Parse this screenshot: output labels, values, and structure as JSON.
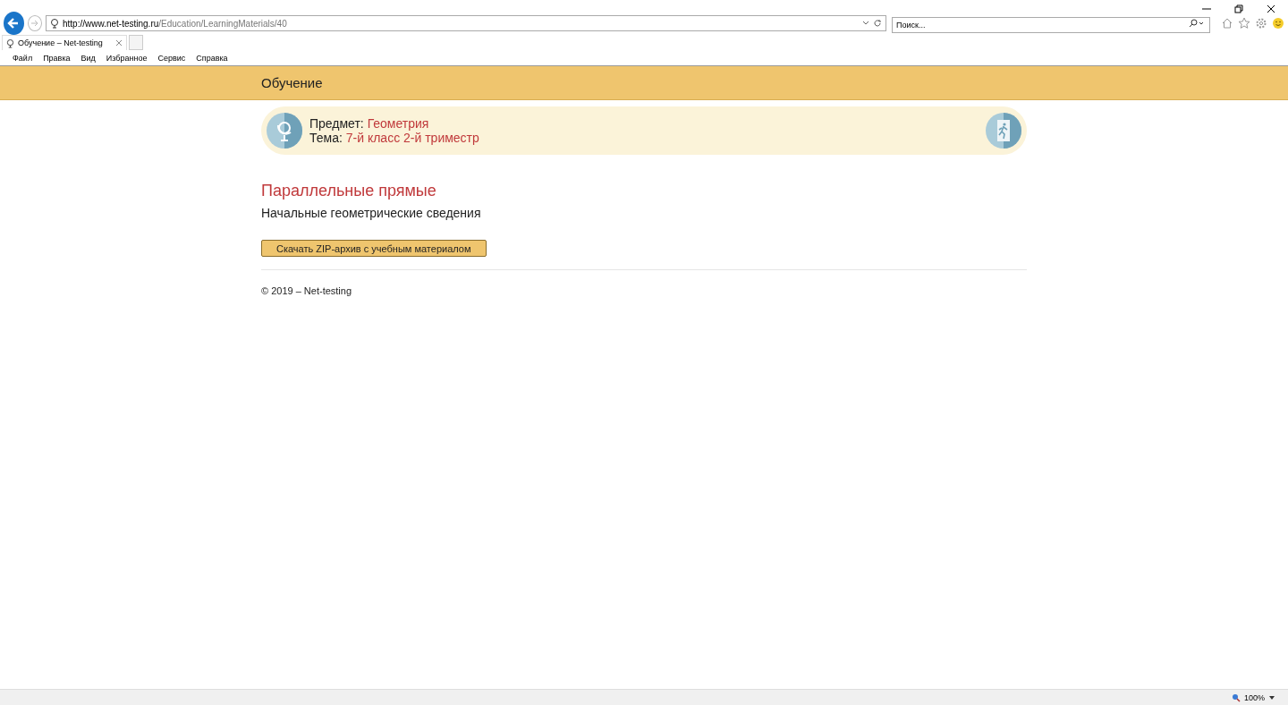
{
  "browser": {
    "address_host": "http://www.net-testing.ru",
    "address_path": "/Education/LearningMaterials/40",
    "search": {
      "placeholder": "Поиск..."
    },
    "tabs": [
      {
        "label": "Обучение – Net-testing",
        "selected": true
      }
    ],
    "menu": [
      "Файл",
      "Правка",
      "Вид",
      "Избранное",
      "Сервис",
      "Справка"
    ],
    "zoom": "100%"
  },
  "header": {
    "title": "Обучение"
  },
  "info": [
    {
      "label": "Предмет:",
      "value": "Геометрия"
    },
    {
      "label": "Тема:",
      "value": "7-й класс 2-й триместр"
    }
  ],
  "heading": "Параллельные прямые",
  "subtitle": "Начальные геометрические сведения",
  "download_button": "Скачать ZIP-архив с учебным материалом",
  "footer": "© 2019 – Net-testing"
}
